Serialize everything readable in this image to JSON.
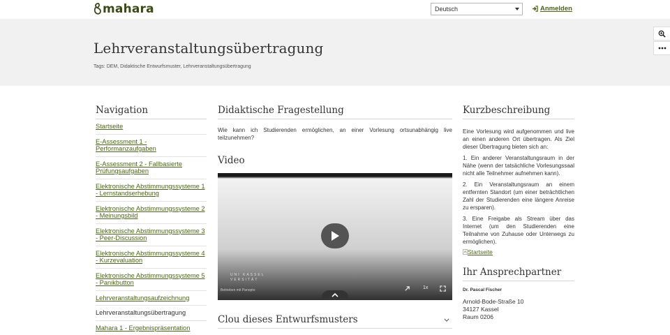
{
  "header": {
    "logo_text": "mahara",
    "language_select": "Deutsch",
    "login_label": "Anmelden",
    "colors": {
      "brand": "#4a6519"
    }
  },
  "banner": {
    "title": "Lehrveranstaltungsübertragung",
    "tags_label": "Tags:",
    "tags": "DEM, Didaktische Entwurfsmuster, Lehrveranstaltungsübertragung",
    "tools": [
      "zoom-icon",
      "more-icon"
    ]
  },
  "navigation": {
    "heading": "Navigation",
    "items": [
      {
        "label": "Startseite"
      },
      {
        "label": "E-Assessment 1 - Performanzaufgaben"
      },
      {
        "label": "E-Assessment 2 - Fallbasierte Prüfungsaufgaben"
      },
      {
        "label": "Elektronische Abstimmungssysteme 1 - Lernstandserhebung"
      },
      {
        "label": "Elektronische Abstimmungssysteme 2 - Meinungsbild"
      },
      {
        "label": "Elektronische Abstimmungssysteme 3 - Peer-Discussion"
      },
      {
        "label": "Elektronische Abstimmungssysteme 4 - Kurzevaluation"
      },
      {
        "label": "Elektronische Abstimmungssysteme 5 - Panikbutton"
      },
      {
        "label": "Lehrveranstaltungsaufzeichnung"
      },
      {
        "label": "Lehrveranstaltungsübertragung"
      },
      {
        "label": "Mahara 1 - Ergebnispräsentation"
      }
    ],
    "current_index": 9
  },
  "main": {
    "question_heading": "Didaktische Fragestellung",
    "question_text": "Wie kann ich Studierenden ermöglichen, an einer Vorlesung ortsunabhängig live teilzunehmen?",
    "video_heading": "Video",
    "video": {
      "watermark_line1": "UNI KASSEL",
      "watermark_line2": "VERSITÄT",
      "powered_by": "Betrieben mit Panopto",
      "speed": "1x"
    },
    "accordion_heading": "Clou dieses Entwurfsmusters"
  },
  "summary": {
    "heading": "Kurzbeschreibung",
    "intro": "Eine Vorlesung wird aufgenommen und live an einen anderen Ort übertragen. Als Ziel dieser Übertragung bieten sich an:",
    "points": [
      "1. Ein anderer Veranstaltungsraum in der Nähe (wenn der tatsächliche Vorlesungssaal nicht alle Teilnehmer aufnehmen kann).",
      "2. Ein Veranstaltungsraum an einem entfernten Standort (um einer beträchtlichen Zahl der Studierenden eine längere Anreise zu ersparen).",
      "3. Eine Freigabe als Stream über das Internet (um den Studierenden eine Teilnahme von Zuhause oder Unterwegs zu ermöglichen)."
    ],
    "image_link": "Startseite"
  },
  "contact": {
    "heading": "Ihr Ansprechpartner",
    "name": "Dr. Pascal Fischer",
    "street": "Arnold-Bode-Straße 10",
    "city": "34127 Kassel",
    "room": "Raum 0206"
  }
}
